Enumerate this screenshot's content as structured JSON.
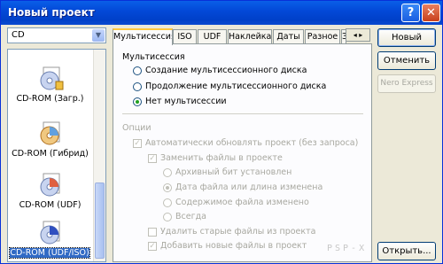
{
  "window": {
    "title": "Новый проект",
    "help_glyph": "?",
    "close_glyph": "✕"
  },
  "disc_type": {
    "value": "CD"
  },
  "project_list": {
    "items": [
      {
        "label": "CD-ROM (Загр.)",
        "icon": "cd-rom-boot-icon"
      },
      {
        "label": "CD-ROM (Гибрид)",
        "icon": "cd-rom-hybrid-icon"
      },
      {
        "label": "CD-ROM (UDF)",
        "icon": "cd-rom-udf-icon"
      },
      {
        "label": "CD-ROM (UDF/ISO)",
        "icon": "cd-rom-udf-iso-icon",
        "selected": true
      }
    ]
  },
  "tabs": [
    "Мультисессия",
    "ISO",
    "UDF",
    "Наклейка",
    "Даты",
    "Разное",
    "З"
  ],
  "tab_scroll": "◂ ▸",
  "multisession": {
    "group_label": "Мультисессия",
    "options": [
      {
        "label": "Создание мультисессионного диска",
        "checked": false
      },
      {
        "label": "Продолжение мультисессионного диска",
        "checked": false
      },
      {
        "label": "Нет мультисессии",
        "checked": true
      }
    ]
  },
  "options": {
    "group_label": "Опции",
    "auto_update": "Автоматически обновлять проект (без запроса)",
    "replace_files": "Заменить файлы в проекте",
    "replace_modes": [
      {
        "label": "Архивный бит установлен",
        "checked": false
      },
      {
        "label": "Дата файла или длина изменена",
        "checked": true
      },
      {
        "label": "Содержимое файла изменено",
        "checked": false
      },
      {
        "label": "Всегда",
        "checked": false
      }
    ],
    "delete_old": "Удалить старые файлы из проекта",
    "add_new": "Добавить новые файлы в проект"
  },
  "buttons": {
    "new": "Новый",
    "cancel": "Отменить",
    "nero_express": "Nero Express",
    "open": "Открыть..."
  },
  "watermark": "PSP-X"
}
